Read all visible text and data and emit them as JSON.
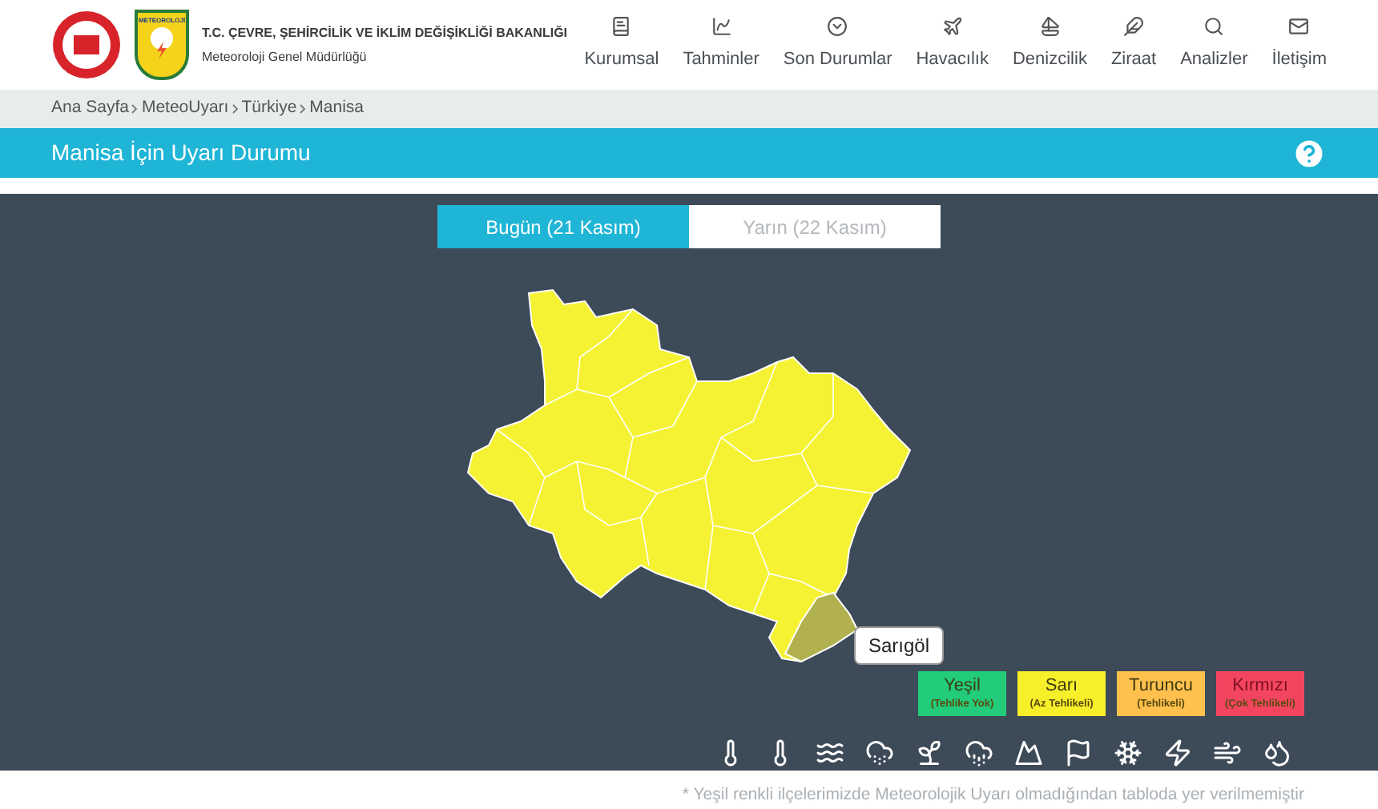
{
  "header": {
    "logo_text": "METEOROLOJİ",
    "ministry": "T.C. ÇEVRE, ŞEHİRCİLİK VE İKLİM DEĞİŞİKLİĞİ BAKANLIĞI",
    "agency": "Meteoroloji Genel Müdürlüğü"
  },
  "nav": [
    {
      "label": "Kurumsal"
    },
    {
      "label": "Tahminler"
    },
    {
      "label": "Son Durumlar"
    },
    {
      "label": "Havacılık"
    },
    {
      "label": "Denizcilik"
    },
    {
      "label": "Ziraat"
    },
    {
      "label": "Analizler"
    },
    {
      "label": "İletişim"
    }
  ],
  "breadcrumb": [
    "Ana Sayfa",
    "MeteoUyarı",
    "Türkiye",
    "Manisa"
  ],
  "title": "Manisa İçin Uyarı Durumu",
  "tabs": [
    {
      "label": "Bugün (21 Kasım)",
      "selected": true
    },
    {
      "label": "Yarın (22 Kasım)",
      "selected": false
    }
  ],
  "map": {
    "tooltip": "Sarıgöl"
  },
  "legend": [
    {
      "label": "Yeşil",
      "note": "(Tehlike Yok)",
      "color": "#22cc7a"
    },
    {
      "label": "Sarı",
      "note": "(Az Tehlikeli)",
      "color": "#f7ef2a"
    },
    {
      "label": "Turuncu",
      "note": "(Tehlikeli)",
      "color": "#ffc04d"
    },
    {
      "label": "Kırmızı",
      "note": "(Çok Tehlikeli)",
      "color": "#f44560"
    }
  ],
  "footnote": "* Yeşil renkli ilçelerimizde Meteorolojik Uyarı olmadığından tabloda yer verilmemiştir"
}
